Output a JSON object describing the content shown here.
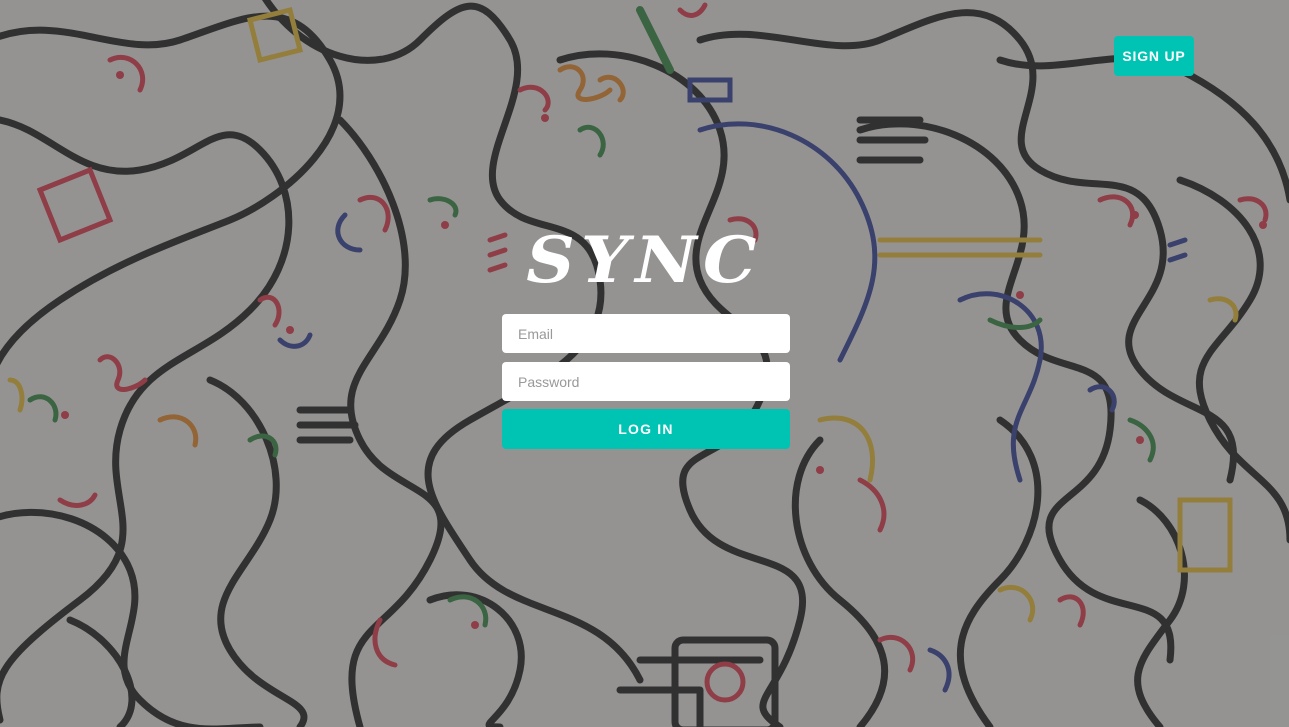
{
  "header": {
    "signup_label": "SIGN UP"
  },
  "brand": {
    "logo_text": "SYNC"
  },
  "login_form": {
    "email_placeholder": "Email",
    "password_placeholder": "Password",
    "login_label": "LOG IN"
  },
  "colors": {
    "accent": "#00c4b3",
    "overlay": "#5a5a5a",
    "line": "#1a1a1a",
    "doodle_red": "#e8344a",
    "doodle_blue": "#2b3d9c",
    "doodle_yellow": "#f4c430",
    "doodle_green": "#2e8b3e",
    "doodle_orange": "#f08a24"
  },
  "background": {
    "icon": "doodle-faces-illustration"
  }
}
